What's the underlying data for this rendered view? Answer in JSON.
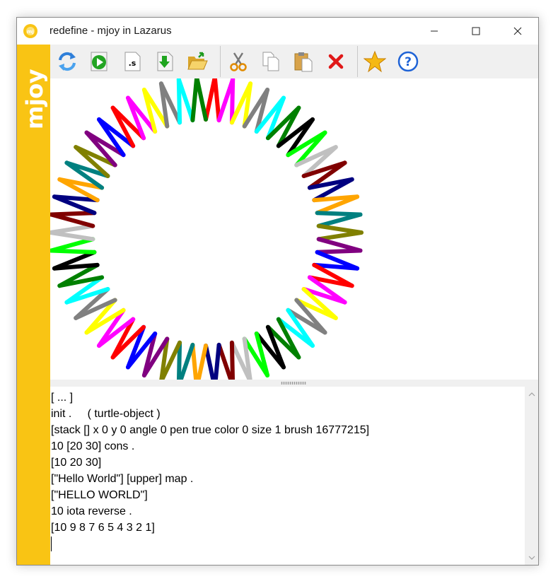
{
  "window": {
    "title": "redefine - mjoy in Lazarus",
    "icon": "mjoy-app-icon",
    "controls": [
      "minimize-icon",
      "maximize-icon",
      "close-icon"
    ]
  },
  "sidebar": {
    "label": "mjoy",
    "color": "#f9c414"
  },
  "toolbar": {
    "buttons": [
      {
        "name": "refresh-icon"
      },
      {
        "name": "run-icon"
      },
      {
        "name": "source-file-icon",
        "glyph": ".s"
      },
      {
        "name": "download-icon"
      },
      {
        "name": "open-folder-icon"
      },
      {
        "name": "cut-icon"
      },
      {
        "name": "copy-icon"
      },
      {
        "name": "paste-icon"
      },
      {
        "name": "delete-icon"
      },
      {
        "name": "favorite-star-icon"
      },
      {
        "name": "help-icon"
      }
    ]
  },
  "canvas": {
    "drawing": "turtle zigzag ring",
    "stroke_colors": [
      "#ff0000",
      "#ff00ff",
      "#ffff00",
      "#808080",
      "#00ffff",
      "#008000",
      "#000000",
      "#00ff00",
      "#c0c0c0",
      "#800000",
      "#000080",
      "#ffa500",
      "#008080",
      "#808000",
      "#800080",
      "#0000ff"
    ]
  },
  "console": {
    "lines": [
      "[ ... ]",
      "init .     ( turtle-object )",
      "[stack [] x 0 y 0 angle 0 pen true color 0 size 1 brush 16777215]",
      "10 [20 30] cons .",
      "[10 20 30]",
      "[\"Hello World\"] [upper] map .",
      "[\"HELLO WORLD\"]",
      "10 iota reverse .",
      "[10 9 8 7 6 5 4 3 2 1]"
    ]
  }
}
